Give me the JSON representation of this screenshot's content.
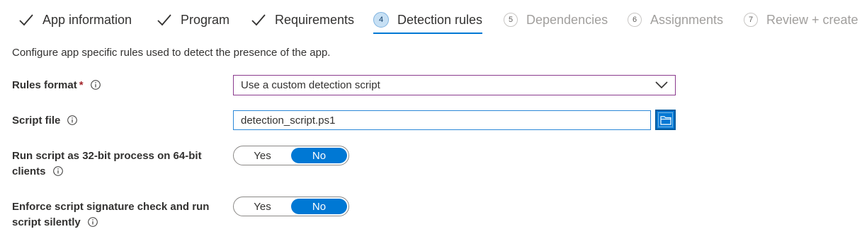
{
  "wizard": {
    "steps": [
      {
        "label": "App information",
        "state": "done"
      },
      {
        "label": "Program",
        "state": "done"
      },
      {
        "label": "Requirements",
        "state": "done"
      },
      {
        "label": "Detection rules",
        "state": "current",
        "number": "4"
      },
      {
        "label": "Dependencies",
        "state": "pending",
        "number": "5"
      },
      {
        "label": "Assignments",
        "state": "pending",
        "number": "6"
      },
      {
        "label": "Review + create",
        "state": "pending",
        "number": "7"
      }
    ]
  },
  "description": "Configure app specific rules used to detect the presence of the app.",
  "form": {
    "rules_format": {
      "label": "Rules format",
      "required_mark": "*",
      "value": "Use a custom detection script"
    },
    "script_file": {
      "label": "Script file",
      "value": "detection_script.ps1"
    },
    "run_32bit": {
      "label_line1": "Run script as 32-bit process on 64-bit",
      "label_line2": "clients",
      "yes_label": "Yes",
      "no_label": "No",
      "selected": "No"
    },
    "enforce_signature": {
      "label_line1": "Enforce script signature check and run",
      "label_line2": "script silently",
      "yes_label": "Yes",
      "no_label": "No",
      "selected": "No"
    }
  },
  "colors": {
    "accent": "#0078d4",
    "select_border": "#8a3b8e",
    "required": "#a4262c",
    "pending_text": "#a19f9d"
  },
  "icons": {
    "done_step": "checkmark-icon",
    "info": "info-icon",
    "dropdown": "chevron-down-icon",
    "browse": "folder-icon"
  }
}
